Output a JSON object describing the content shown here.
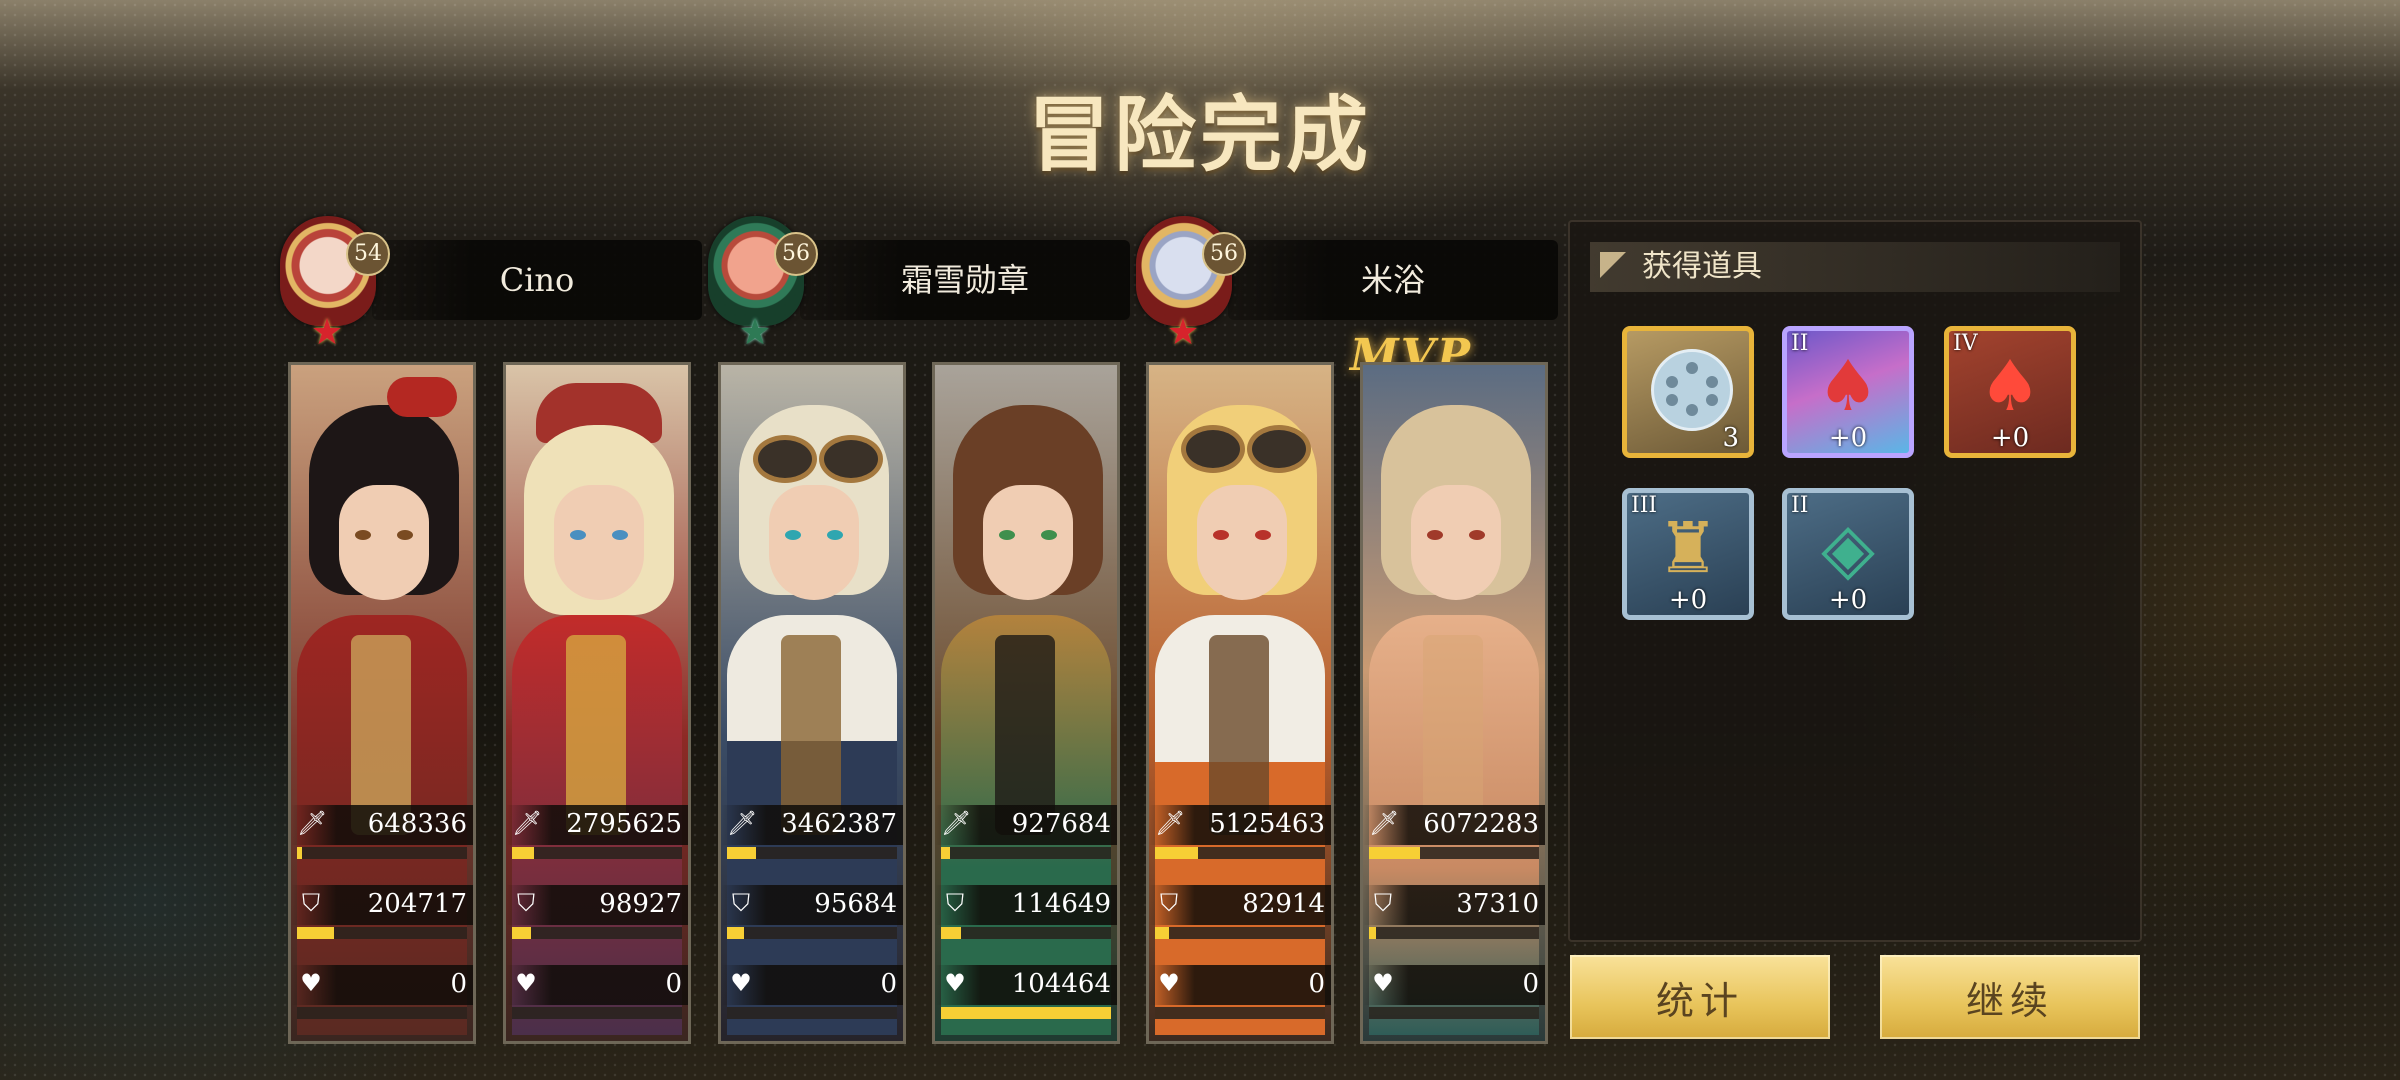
{
  "title": "冒险完成",
  "mvp_label": "MVP",
  "players": [
    {
      "name": "Cino",
      "level": "54"
    },
    {
      "name": "霜雪勋章",
      "level": "56"
    },
    {
      "name": "米浴",
      "level": "56"
    }
  ],
  "heroes": [
    {
      "attack": "648336",
      "attack_pct": 0.03,
      "defense": "204717",
      "defense_pct": 0.22,
      "heal": "0",
      "heal_pct": 0
    },
    {
      "attack": "2795625",
      "attack_pct": 0.13,
      "defense": "98927",
      "defense_pct": 0.11,
      "heal": "0",
      "heal_pct": 0
    },
    {
      "attack": "3462387",
      "attack_pct": 0.17,
      "defense": "95684",
      "defense_pct": 0.1,
      "heal": "0",
      "heal_pct": 0
    },
    {
      "attack": "927684",
      "attack_pct": 0.05,
      "defense": "114649",
      "defense_pct": 0.12,
      "heal": "104464",
      "heal_pct": 1.0
    },
    {
      "attack": "5125463",
      "attack_pct": 0.25,
      "defense": "82914",
      "defense_pct": 0.08,
      "heal": "0",
      "heal_pct": 0
    },
    {
      "attack": "6072283",
      "attack_pct": 0.3,
      "defense": "37310",
      "defense_pct": 0.04,
      "heal": "0",
      "heal_pct": 0
    }
  ],
  "items_panel": {
    "title": "获得道具",
    "items": [
      {
        "icon": "film-reel-icon",
        "rank": "",
        "count": "3"
      },
      {
        "icon": "card-suit-icon",
        "rank": "II",
        "count": "+0"
      },
      {
        "icon": "card-suit-icon",
        "rank": "IV",
        "count": "+0"
      },
      {
        "icon": "anubis-idol-icon",
        "rank": "III",
        "count": "+0"
      },
      {
        "icon": "jade-coin-icon",
        "rank": "II",
        "count": "+0"
      }
    ]
  },
  "buttons": {
    "stats": "统计",
    "continue": "继续"
  },
  "colors": {
    "title": "#f7e7bf",
    "bar": "#f7cf35",
    "button": "#e8c45b"
  }
}
